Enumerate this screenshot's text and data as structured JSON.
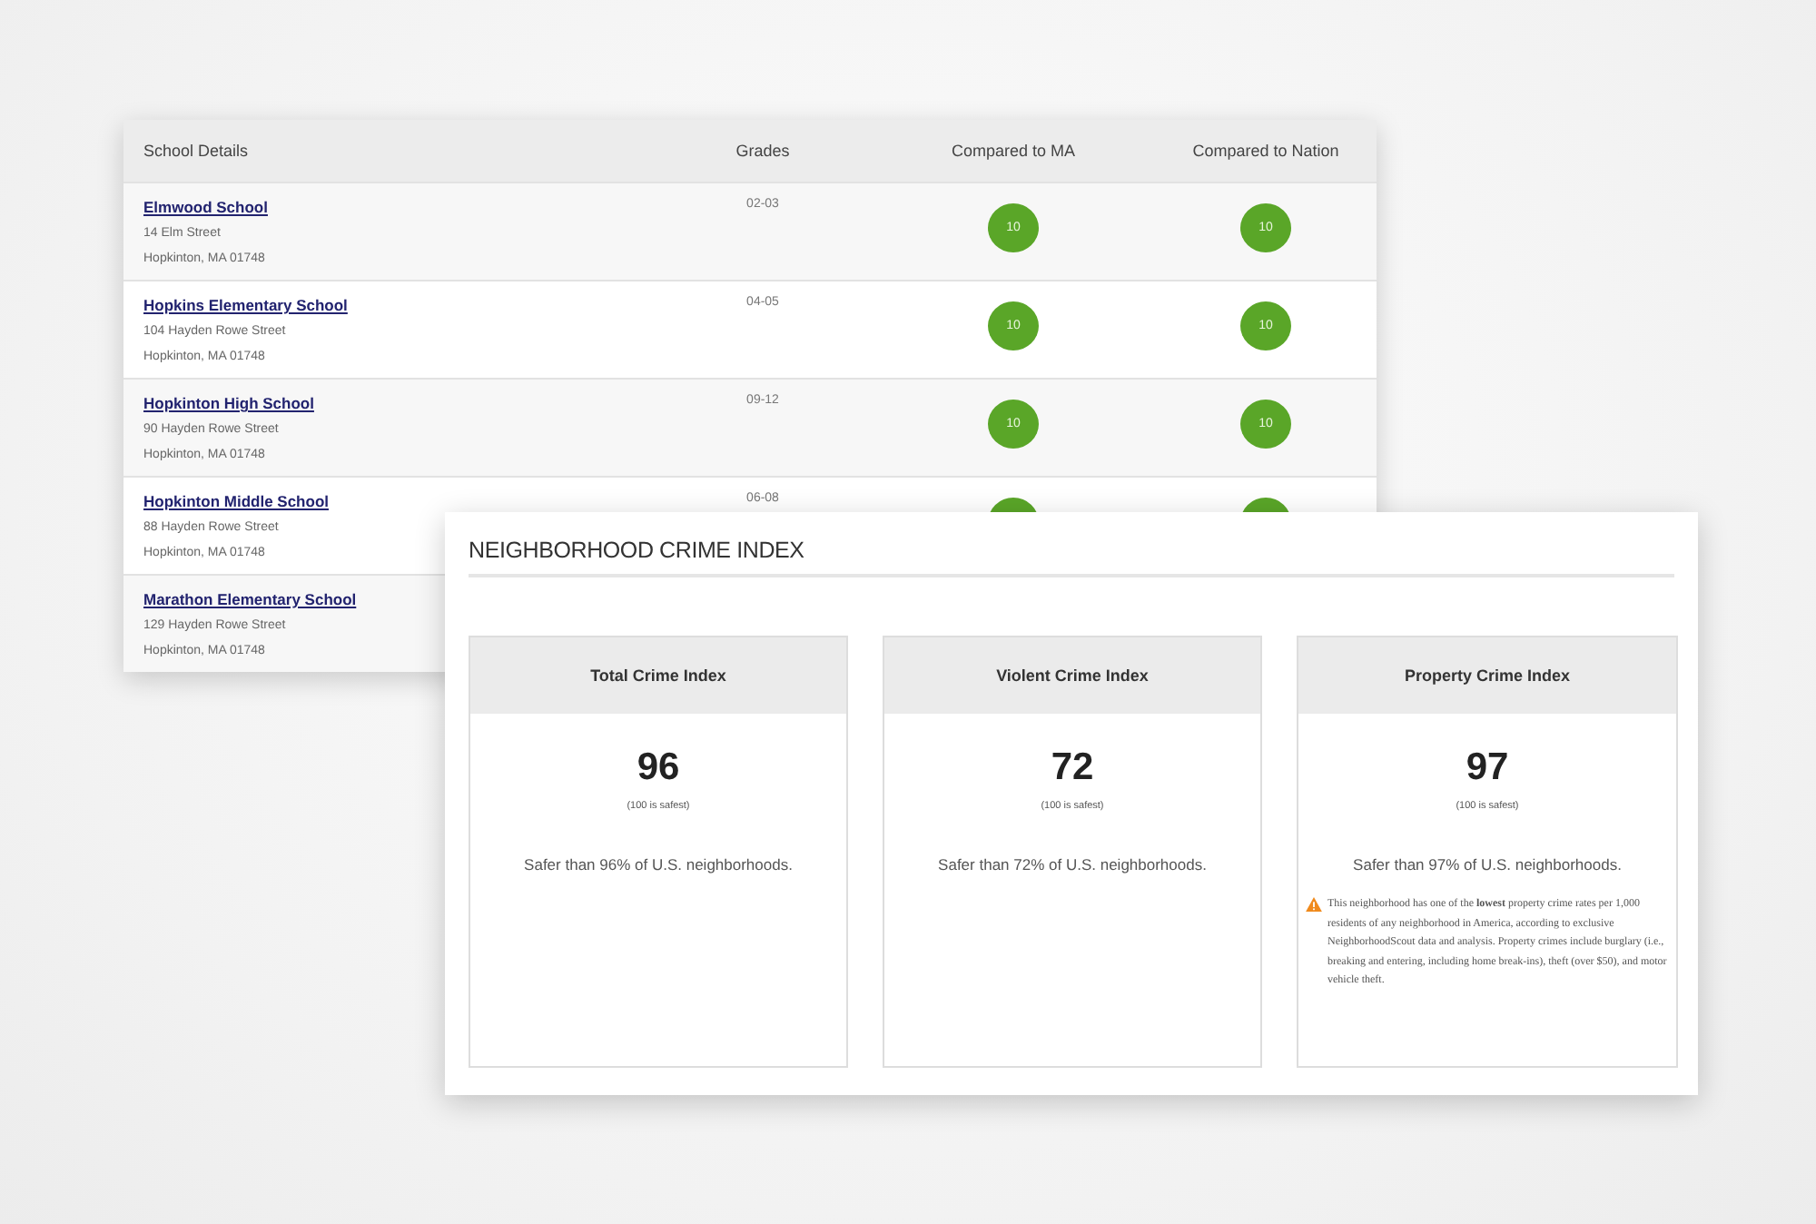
{
  "schools_table": {
    "columns": [
      "School Details",
      "Grades",
      "Compared to MA",
      "Compared to Nation"
    ],
    "rows": [
      {
        "name": "Elmwood School",
        "street": "14 Elm Street",
        "city": "Hopkinton, MA 01748",
        "grades": "02-03",
        "ma": "10",
        "nation": "10"
      },
      {
        "name": "Hopkins Elementary School",
        "street": "104 Hayden Rowe Street",
        "city": "Hopkinton, MA 01748",
        "grades": "04-05",
        "ma": "10",
        "nation": "10"
      },
      {
        "name": "Hopkinton High School",
        "street": "90 Hayden Rowe Street",
        "city": "Hopkinton, MA 01748",
        "grades": "09-12",
        "ma": "10",
        "nation": "10"
      },
      {
        "name": "Hopkinton Middle School",
        "street": "88 Hayden Rowe Street",
        "city": "Hopkinton, MA 01748",
        "grades": "06-08",
        "ratings_shown": true
      },
      {
        "name": "Marathon Elementary School",
        "street": "129 Hayden Rowe Street",
        "city": "Hopkinton, MA 01748"
      }
    ]
  },
  "crime_panel": {
    "title": "NEIGHBORHOOD CRIME INDEX",
    "cards": [
      {
        "heading": "Total Crime Index",
        "score": "96",
        "scale": "(100 is safest)",
        "summary": "Safer than 96% of U.S. neighborhoods."
      },
      {
        "heading": "Violent Crime Index",
        "score": "72",
        "scale": "(100 is safest)",
        "summary": "Safer than 72% of U.S. neighborhoods."
      },
      {
        "heading": "Property Crime Index",
        "score": "97",
        "scale": "(100 is safest)",
        "summary": "Safer than 97% of U.S. neighborhoods.",
        "note": "This neighborhood has one of the **lowest** property crime rates per 1,000 residents of any neighborhood in America, according to exclusive NeighborhoodScout data and analysis. Property crimes include burglary (i.e., breaking and entering, including home break-ins), theft (over $50), and motor vehicle theft."
      }
    ]
  }
}
